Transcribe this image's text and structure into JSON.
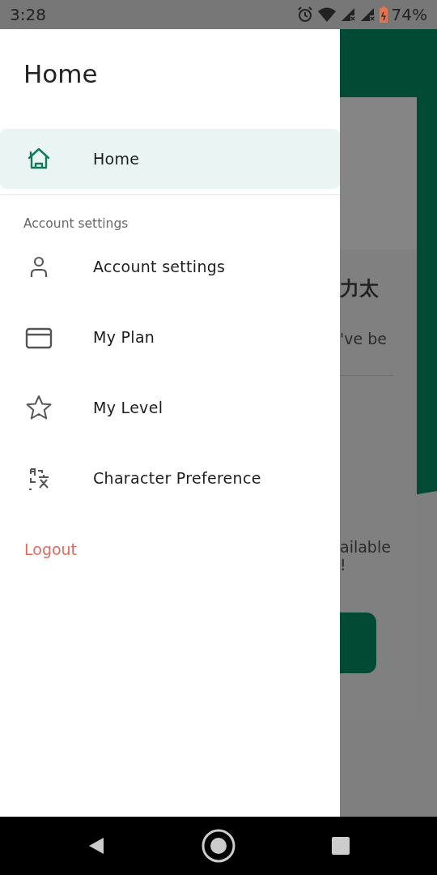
{
  "status_bar": {
    "time": "3:28",
    "battery": "74%"
  },
  "drawer": {
    "title": "Home",
    "top_items": [
      {
        "label": "Home",
        "kind": "home",
        "selected": true
      }
    ],
    "section_label": "Account settings",
    "items": [
      {
        "label": "Account settings",
        "kind": "person",
        "selected": false
      },
      {
        "label": "My Plan",
        "kind": "card",
        "selected": false
      },
      {
        "label": "My Level",
        "kind": "star",
        "selected": false
      },
      {
        "label": "Character Preference",
        "kind": "characters",
        "selected": false
      }
    ],
    "logout": "Logout"
  },
  "background": {
    "heading": "力太",
    "text": "'ve be",
    "notice_lines": [
      "ailable",
      "!"
    ]
  }
}
